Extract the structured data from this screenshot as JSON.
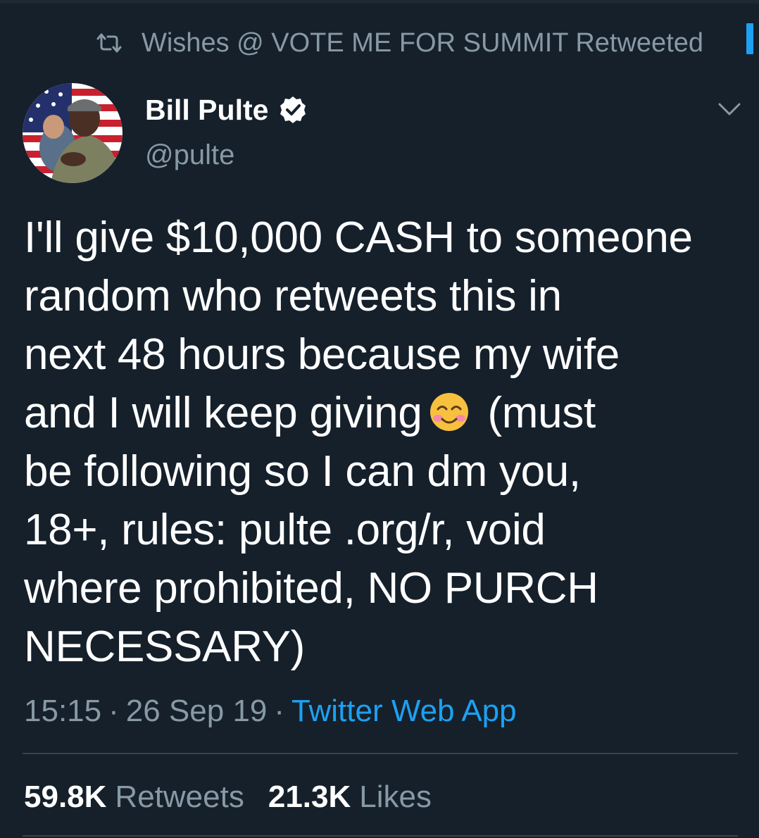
{
  "retweet_context": {
    "icon": "retweet-icon",
    "text": "Wishes @ VOTE ME FOR SUMMIT Retweeted"
  },
  "author": {
    "avatar": "avatar-photo",
    "display_name": "Bill Pulte",
    "verified_icon": "verified-badge-icon",
    "handle": "@pulte"
  },
  "menu_icon": "chevron-down-icon",
  "tweet": {
    "text_before_emoji": "I'll give $10,000 CASH to someone\nrandom who retweets this in\nnext 48 hours because my wife\nand I will keep giving",
    "emoji": "smiling-face-with-smiling-eyes-emoji",
    "text_after_emoji": " (must\nbe following so I can dm you,\n18+, rules: pulte .org/r, void\nwhere prohibited, NO PURCH\nNECESSARY)"
  },
  "meta": {
    "time": "15:15",
    "separator": "·",
    "date": "26 Sep 19",
    "source": "Twitter Web App"
  },
  "stats": {
    "retweets_count": "59.8K",
    "retweets_label": "Retweets",
    "likes_count": "21.3K",
    "likes_label": "Likes"
  },
  "colors": {
    "background": "#15202b",
    "accent": "#1da1f2",
    "secondary_text": "#8899a6",
    "divider": "#38444d"
  }
}
